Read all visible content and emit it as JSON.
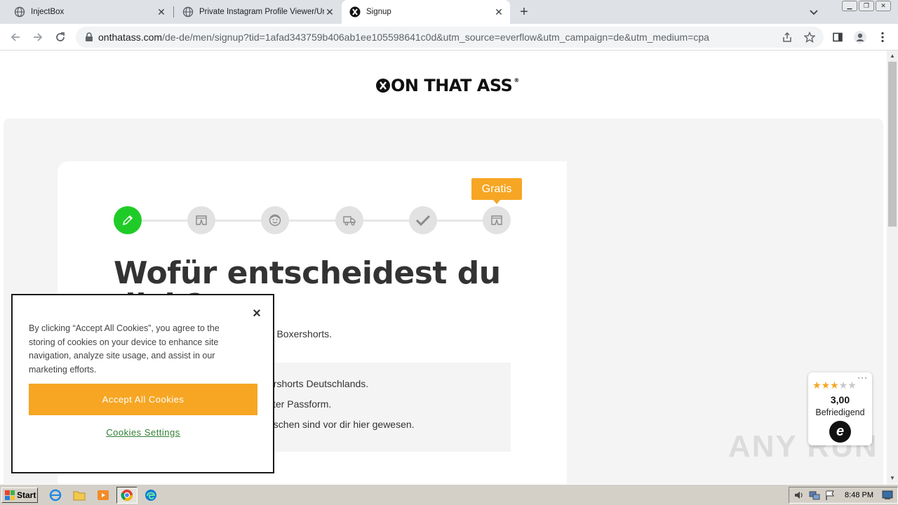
{
  "browser": {
    "tabs": [
      {
        "title": "InjectBox"
      },
      {
        "title": "Private Instagram Profile Viewer/Unl"
      },
      {
        "title": "Signup"
      }
    ],
    "url_host": "onthatass.com",
    "url_path": "/de-de/men/signup?tid=1afad343759b406ab1ee105598641c0d&utm_source=everflow&utm_campaign=de&utm_medium=cpa"
  },
  "page": {
    "logo_text": "ON THAT ASS",
    "logo_mark": "®",
    "badge_gratis": "Gratis",
    "headline_line1": "Wofür entscheidest du",
    "headline_line2": "dich?",
    "subtext": "von Boxershorts.",
    "info_lines": [
      "ershorts Deutschlands.",
      "kter Passform.",
      "nschen sind vor dir hier gewesen."
    ],
    "steps": [
      "edit-step",
      "boxer-step",
      "face-step",
      "truck-step",
      "check-step",
      "gift-boxer-step"
    ]
  },
  "rating_badge": {
    "more": "···",
    "stars_filled": 3,
    "stars_total": 5,
    "score": "3,00",
    "label": "Befriedigend",
    "logo_letter": "e"
  },
  "cookie_banner": {
    "text": "By clicking “Accept All Cookies”, you agree to the storing of cookies on your device to enhance site navigation, analyze site usage, and assist in our marketing efforts.",
    "accept_label": "Accept All Cookies",
    "settings_label": "Cookies Settings",
    "close_glyph": "×"
  },
  "watermark": "ANY RUN",
  "taskbar": {
    "start_label": "Start",
    "clock": "8:48 PM"
  },
  "colors": {
    "accent_orange": "#f6a623",
    "active_green": "#1fcc27",
    "cookie_link": "#2e7d32"
  }
}
